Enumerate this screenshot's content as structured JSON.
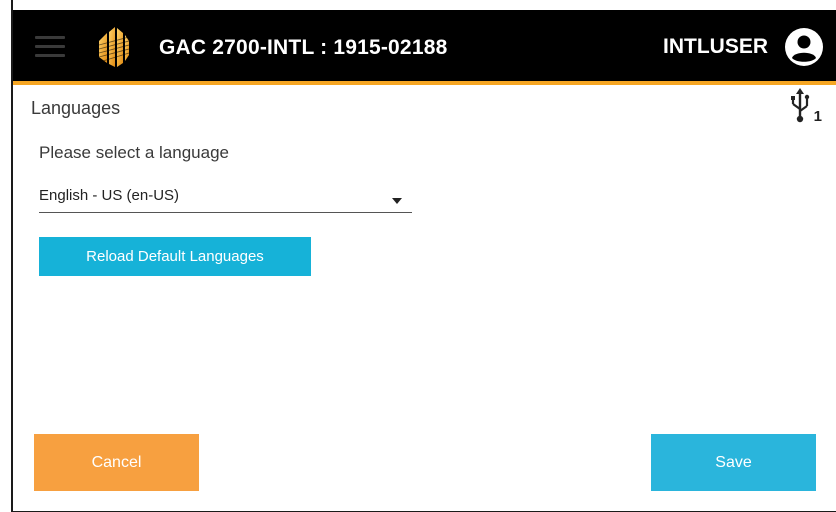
{
  "header": {
    "device_title": "GAC 2700-INTL : 1915-02188",
    "username": "INTLUSER"
  },
  "page": {
    "title": "Languages",
    "usb_count": "1"
  },
  "language": {
    "prompt": "Please select a language",
    "selected": "English - US (en-US)"
  },
  "buttons": {
    "reload_label": "Reload Default Languages",
    "cancel_label": "Cancel",
    "save_label": "Save"
  },
  "colors": {
    "header_bg": "#000000",
    "accent_orange": "#f6a623",
    "primary_blue": "#16b2d8",
    "cancel_orange": "#f7a040"
  }
}
